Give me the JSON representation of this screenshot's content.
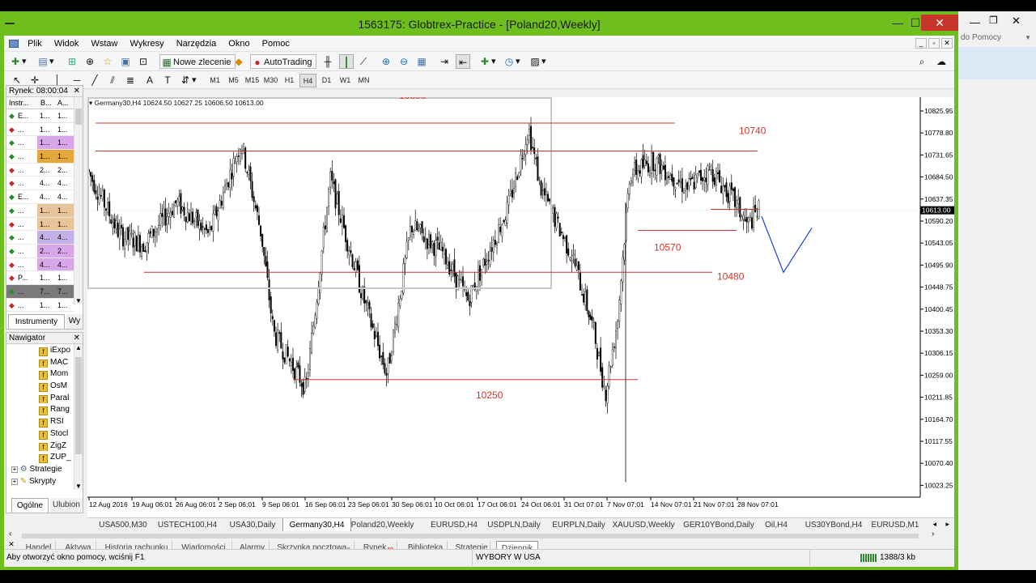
{
  "window": {
    "title": "1563175: Globtrex-Practice - [Poland20,Weekly]"
  },
  "menu": [
    "Plik",
    "Widok",
    "Wstaw",
    "Wykresy",
    "Narzędzia",
    "Okno",
    "Pomoc"
  ],
  "toolbar": {
    "new_order": "Nowe zlecenie",
    "autotrading": "AutoTrading"
  },
  "timeframes": [
    "M1",
    "M5",
    "M15",
    "M30",
    "H1",
    "H4",
    "D1",
    "W1",
    "MN"
  ],
  "selected_timeframe": "H4",
  "market_watch": {
    "title": "Rynek: 08:00:04",
    "headers": [
      "Instr...",
      "B...",
      "A..."
    ],
    "rows": [
      {
        "sym": "E...",
        "bid": "1...",
        "ask": "1...",
        "dir": "up",
        "bg": "#ffffff"
      },
      {
        "sym": "...",
        "bid": "1...",
        "ask": "1...",
        "dir": "down",
        "bg": "#ffffff"
      },
      {
        "sym": "...",
        "bid": "1...",
        "ask": "1...",
        "dir": "up",
        "bg": "#d9a6e8"
      },
      {
        "sym": "...",
        "bid": "1...",
        "ask": "1...",
        "dir": "up",
        "bg": "#e3a73a"
      },
      {
        "sym": "...",
        "bid": "2...",
        "ask": "2...",
        "dir": "down",
        "bg": "#ffffff"
      },
      {
        "sym": "...",
        "bid": "4...",
        "ask": "4...",
        "dir": "down",
        "bg": "#ffffff"
      },
      {
        "sym": "E...",
        "bid": "4...",
        "ask": "4...",
        "dir": "up",
        "bg": "#ffffff"
      },
      {
        "sym": "...",
        "bid": "1...",
        "ask": "1...",
        "dir": "up",
        "bg": "#e8c49a"
      },
      {
        "sym": "...",
        "bid": "1...",
        "ask": "1...",
        "dir": "down",
        "bg": "#e8c49a"
      },
      {
        "sym": "...",
        "bid": "4...",
        "ask": "4...",
        "dir": "up",
        "bg": "#c3b0e8"
      },
      {
        "sym": "...",
        "bid": "2...",
        "ask": "2...",
        "dir": "up",
        "bg": "#d9a6e8"
      },
      {
        "sym": "...",
        "bid": "4...",
        "ask": "4...",
        "dir": "down",
        "bg": "#d9a6e8"
      },
      {
        "sym": "P...",
        "bid": "1...",
        "ask": "1...",
        "dir": "down",
        "bg": "#ffffff"
      },
      {
        "sym": "...",
        "bid": "7...",
        "ask": "7...",
        "dir": "up",
        "bg": "#7a7a7a"
      },
      {
        "sym": "...",
        "bid": "1...",
        "ask": "1...",
        "dir": "down",
        "bg": "#ffffff"
      }
    ],
    "tabs": [
      "Instrumenty",
      "Wy"
    ]
  },
  "navigator": {
    "title": "Nawigator",
    "items": [
      "iExpo",
      "MAC",
      "Mom",
      "OsM",
      "Paral",
      "Rang",
      "RSI",
      "Stocl",
      "ZigZ",
      "ZUP_"
    ],
    "groups": [
      "Strategie",
      "Skrypty"
    ],
    "tabs": [
      "Ogólne",
      "Ulubion"
    ]
  },
  "chart": {
    "info": "Germany30,H4   10624.50 10627.25 10606.50 10613.00",
    "price_labels": [
      "10825.95",
      "10778.80",
      "10731.65",
      "10684.50",
      "10637.35",
      "10590.20",
      "10543.05",
      "10495.90",
      "10448.75",
      "10400.45",
      "10353.30",
      "10306.15",
      "10259.00",
      "10211.85",
      "10164.70",
      "10117.55",
      "10070.40",
      "10023.25"
    ],
    "current_price": "10613.00",
    "time_labels": [
      "12 Aug 2016",
      "19 Aug 06:01",
      "26 Aug 06:01",
      "2 Sep 06:01",
      "9 Sep 06:01",
      "16 Sep 06:01",
      "23 Sep 06:01",
      "30 Sep 06:01",
      "10 Oct 06:01",
      "17 Oct 06:01",
      "24 Oct 06:01",
      "31 Oct 07:01",
      "7 Nov 07:01",
      "14 Nov 07:01",
      "21 Nov 07:01",
      "28 Nov 07:01"
    ],
    "levels": [
      "10800",
      "10740",
      "10570",
      "10480",
      "10250"
    ]
  },
  "chart_tabs": [
    "USA500,M30",
    "USTECH100,H4",
    "USA30,Daily",
    "Germany30,H4",
    "Poland20,Weekly",
    "EURUSD,H4",
    "USDPLN,Daily",
    "EURPLN,Daily",
    "XAUUSD,Weekly",
    "GER10YBond,Daily",
    "Oil,H4",
    "US30YBond,H4",
    "EURUSD,M1"
  ],
  "active_chart_tab": "Germany30,H4",
  "bottom_tabs": {
    "items": [
      "Handel",
      "Aktywa",
      "Historia rachunku",
      "Wiadomości",
      "Alarmy",
      "Skrzynka pocztowa",
      "Rynek",
      "Biblioteka",
      "Strategie",
      "Dziennik"
    ],
    "mail_count": "8",
    "market_count": "49",
    "active": "Dziennik"
  },
  "status": {
    "help": "Aby otworzyć okno pomocy, wciśnij F1",
    "profile": "WYBORY W USA",
    "traffic": "1388/3 kb"
  },
  "right_window": {
    "search": "do Pomocy"
  },
  "colors": {
    "frame": "#6ebe1e",
    "level_line": "#c0392b",
    "level_text": "#d93025",
    "projection": "#1a3fd6"
  }
}
